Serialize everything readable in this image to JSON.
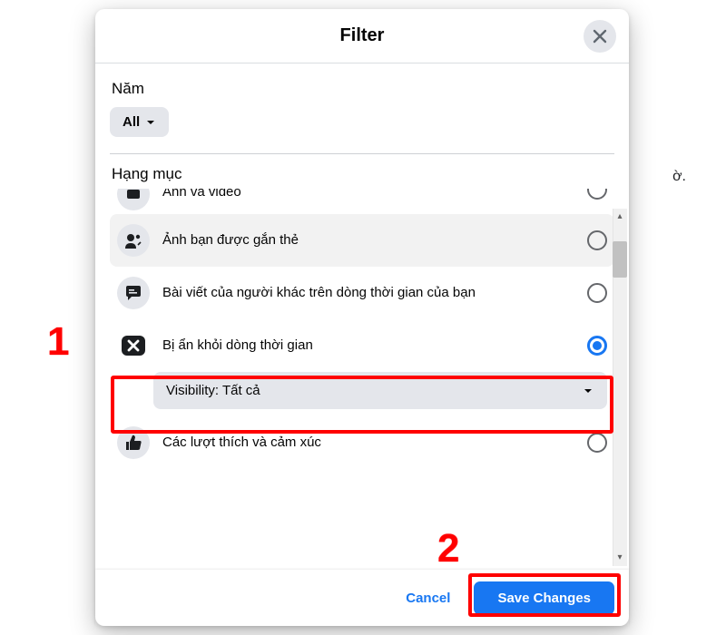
{
  "outside_text": "ờ.",
  "modal": {
    "title": "Filter",
    "close_icon": "close-icon",
    "year_section_label": "Năm",
    "year_selected": "All",
    "category_section_label": "Hạng mục",
    "items": [
      {
        "icon": "photo-video-icon",
        "label": "Ảnh và video",
        "selected": false
      },
      {
        "icon": "people-tag-icon",
        "label": "Ảnh bạn được gắn thẻ",
        "selected": false
      },
      {
        "icon": "comment-icon",
        "label": "Bài viết của người khác trên dòng thời gian của bạn",
        "selected": false
      },
      {
        "icon": "hidden-icon",
        "label": "Bị ẩn khỏi dòng thời gian",
        "selected": true
      },
      {
        "icon": "like-icon",
        "label": "Các lượt thích và cảm xúc",
        "selected": false
      }
    ],
    "visibility_row": "Visibility: Tất cả",
    "footer": {
      "cancel": "Cancel",
      "save": "Save Changes"
    }
  },
  "annotations": {
    "num1": "1",
    "num2": "2"
  }
}
